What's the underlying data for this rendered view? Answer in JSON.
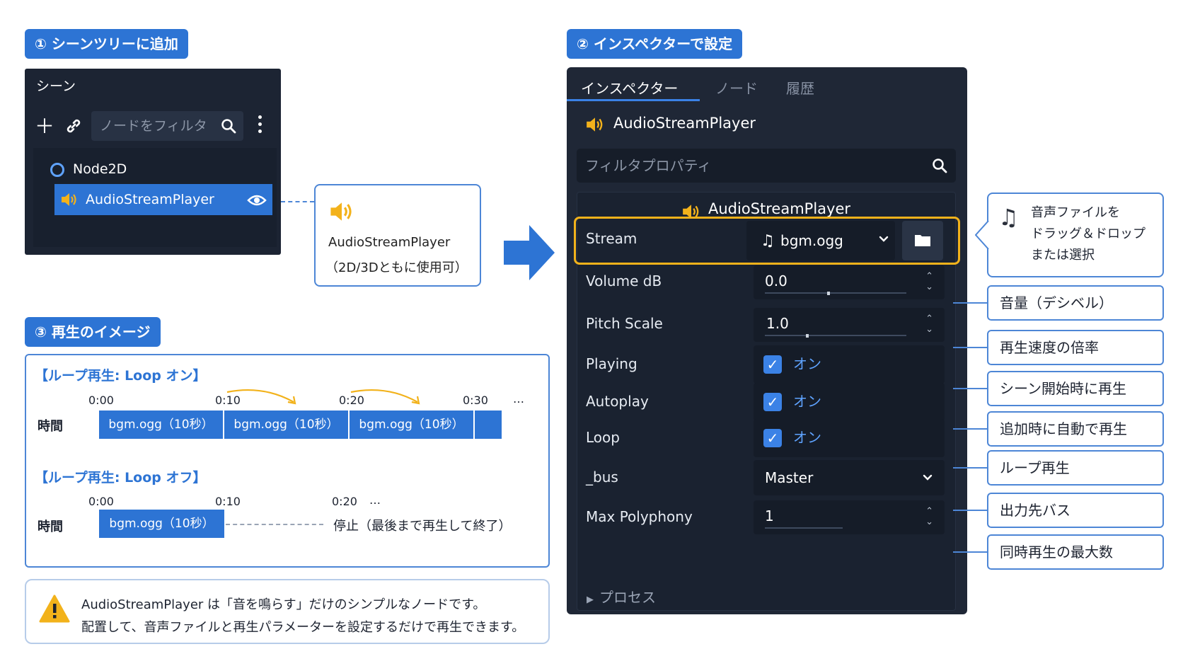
{
  "steps": {
    "step1": "① シーンツリーに追加",
    "step2": "② インスペクターで設定",
    "step3": "③ 再生のイメージ"
  },
  "scene_panel": {
    "title": "シーン",
    "filter_placeholder": "ノードをフィルタ",
    "root_node": "Node2D",
    "selected_node": "AudioStreamPlayer"
  },
  "node_callout": {
    "name": "AudioStreamPlayer",
    "note": "（2D/3Dともに使用可）"
  },
  "inspector": {
    "tabs": [
      "インスペクター",
      "ノード",
      "履歴"
    ],
    "header": "AudioStreamPlayer",
    "filter_placeholder": "フィルタプロパティ",
    "section": "AudioStreamPlayer",
    "stream": {
      "label": "Stream",
      "value": "bgm.ogg"
    },
    "volume_db": {
      "label": "Volume dB",
      "value": "0.0",
      "level": 0.45
    },
    "pitch_scale": {
      "label": "Pitch Scale",
      "value": "1.0",
      "level": 0.3
    },
    "playing": {
      "label": "Playing",
      "value": "オン",
      "checked": true
    },
    "autoplay": {
      "label": "Autoplay",
      "value": "オン",
      "checked": true
    },
    "loop": {
      "label": "Loop",
      "value": "オン",
      "checked": true
    },
    "bus": {
      "label": "_bus",
      "value": "Master"
    },
    "max_polyphony": {
      "label": "Max Polyphony",
      "value": "1"
    },
    "process": "プロセス"
  },
  "side_notes": {
    "stream_tip": [
      "音声ファイルを",
      "ドラッグ＆ドロップ",
      "または選択"
    ],
    "volume": "音量（デシベル）",
    "pitch": "再生速度の倍率",
    "playing": "シーン開始時に再生",
    "autoplay": "追加時に自動で再生",
    "loop": "ループ再生",
    "bus": "出力先バス",
    "polyphony": "同時再生の最大数"
  },
  "loop_diagram": {
    "loop_on": {
      "title": "【ループ再生: Loop オン】",
      "ticks": [
        "0:00",
        "0:10",
        "0:20",
        "0:30",
        "…"
      ],
      "row_label": "時間",
      "segments": [
        "bgm.ogg（10秒）",
        "bgm.ogg（10秒）",
        "bgm.ogg（10秒）"
      ]
    },
    "loop_off": {
      "title": "【ループ再生: Loop オフ】",
      "ticks": [
        "0:00",
        "0:10",
        "0:20",
        "…"
      ],
      "row_label": "時間",
      "segment": "bgm.ogg（10秒）",
      "stop_text": "停止（最後まで再生して終了）"
    }
  },
  "note": {
    "line1": "AudioStreamPlayer は「音を鳴らす」だけのシンプルなノードです。",
    "line2": "配置して、音声ファイルと再生パラメーターを設定するだけで再生できます。"
  },
  "colors": {
    "accent": "#2d74d4",
    "panel_dark": "#1f2736",
    "highlight": "#f2b21b",
    "speaker": "#f3b21b"
  }
}
